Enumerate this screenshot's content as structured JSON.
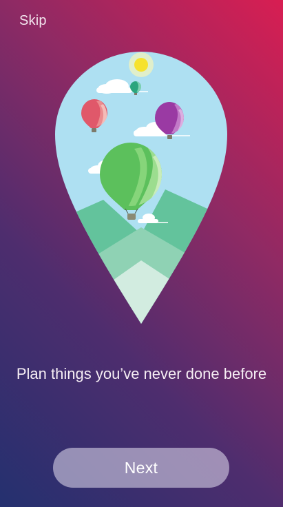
{
  "skip_label": "Skip",
  "tagline": "Plan things you’ve never done before",
  "next_label": "Next",
  "colors": {
    "gradient_top_right": "#d81e52",
    "gradient_bottom_left": "#24306f",
    "sky": "#aee0f2",
    "mountain": "#63c39c",
    "balloon_green": "#5cc05c",
    "balloon_purple": "#9a3aa3",
    "balloon_red": "#e0586a",
    "balloon_teal": "#2aa57e",
    "sun": "#f6e22e"
  }
}
